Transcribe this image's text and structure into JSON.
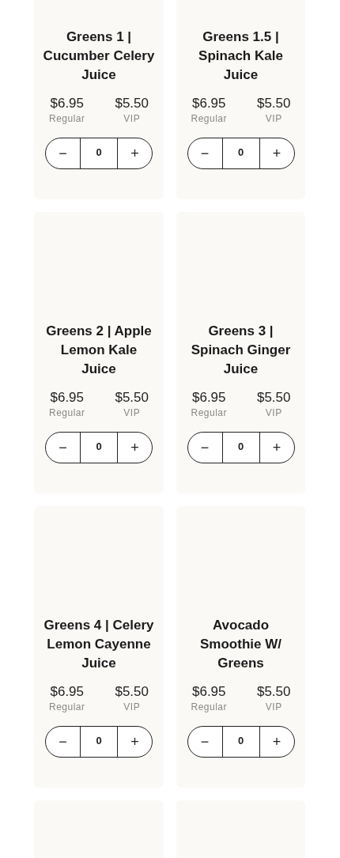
{
  "products": [
    {
      "name": "Greens 1 | Cucumber Celery Juice",
      "regular_price": "$6.95",
      "regular_label": "Regular",
      "vip_price": "$5.50",
      "vip_label": "VIP",
      "quantity": "0",
      "minus": "−",
      "plus": "+"
    },
    {
      "name": "Greens 1.5 | Spinach Kale Juice",
      "regular_price": "$6.95",
      "regular_label": "Regular",
      "vip_price": "$5.50",
      "vip_label": "VIP",
      "quantity": "0",
      "minus": "−",
      "plus": "+"
    },
    {
      "name": "Greens 2 | Apple Lemon Kale Juice",
      "regular_price": "$6.95",
      "regular_label": "Regular",
      "vip_price": "$5.50",
      "vip_label": "VIP",
      "quantity": "0",
      "minus": "−",
      "plus": "+"
    },
    {
      "name": "Greens 3 | Spinach Ginger Juice",
      "regular_price": "$6.95",
      "regular_label": "Regular",
      "vip_price": "$5.50",
      "vip_label": "VIP",
      "quantity": "0",
      "minus": "−",
      "plus": "+"
    },
    {
      "name": "Greens 4 | Celery Lemon Cayenne Juice",
      "regular_price": "$6.95",
      "regular_label": "Regular",
      "vip_price": "$5.50",
      "vip_label": "VIP",
      "quantity": "0",
      "minus": "−",
      "plus": "+"
    },
    {
      "name": "Avocado Smoothie W/ Greens",
      "regular_price": "$6.95",
      "regular_label": "Regular",
      "vip_price": "$5.50",
      "vip_label": "VIP",
      "quantity": "0",
      "minus": "−",
      "plus": "+"
    }
  ],
  "more_cards_below": true
}
